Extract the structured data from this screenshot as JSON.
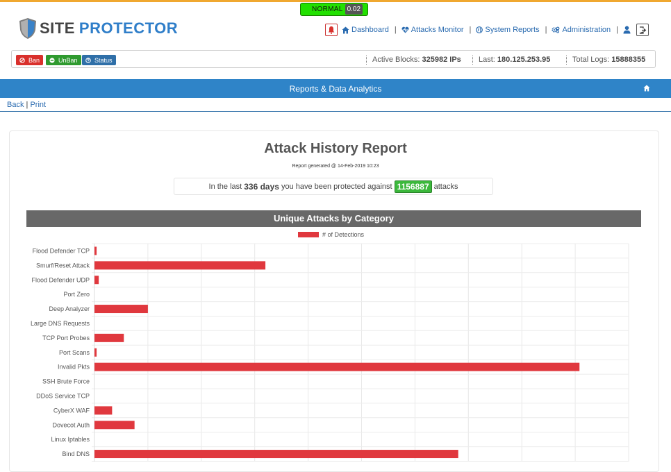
{
  "status_indicator": {
    "label": "NORMAL",
    "value": "0.02"
  },
  "brand": {
    "name_part1": "SITE",
    "name_part2": "PROTECTOR"
  },
  "nav": {
    "dashboard": "Dashboard",
    "attacks_monitor": "Attacks Monitor",
    "system_reports": "System Reports",
    "administration": "Administration",
    "separator": "|"
  },
  "toolbar": {
    "ban": "Ban",
    "unban": "UnBan",
    "status": "Status",
    "active_blocks_label": "Active Blocks:",
    "active_blocks_value": "325982 IPs",
    "last_label": "Last:",
    "last_value": "180.125.253.95",
    "total_logs_label": "Total Logs:",
    "total_logs_value": "15888355"
  },
  "section_bar": {
    "title": "Reports & Data Analytics"
  },
  "breadcrumbs": {
    "back": "Back",
    "sep": " | ",
    "print": "Print"
  },
  "report": {
    "title": "Attack History Report",
    "generated": "Report generated @ 14-Feb-2019 10:23",
    "protected_prefix": "In the last",
    "protected_days": "336 days",
    "protected_middle": "you have been protected against",
    "protected_count": "1156887",
    "protected_suffix": "attacks"
  },
  "colors": {
    "accent_blue": "#2f84c8",
    "bar_red": "#e0383e",
    "ok_green": "#3cb83c",
    "header_gray": "#686868"
  },
  "chart_data": {
    "type": "bar",
    "orientation": "horizontal",
    "title": "Unique Attacks by Category",
    "categories": [
      "Flood Defender TCP",
      "Smurf/Reset Attack",
      "Flood Defender UDP",
      "Port Zero",
      "Deep Analyzer",
      "Large DNS Requests",
      "TCP Port Probes",
      "Port Scans",
      "Invalid Pkts",
      "SSH Brute Force",
      "DDoS Service TCP",
      "CyberX WAF",
      "Dovecot Auth",
      "Linux Iptables",
      "Bind DNS"
    ],
    "series": [
      {
        "name": "# of Detections",
        "values": [
          0.4,
          32,
          0.8,
          0,
          10,
          0,
          5.5,
          0.4,
          90.8,
          0,
          0,
          3.3,
          7.5,
          0,
          68.1
        ]
      }
    ],
    "xlim": [
      0,
      100
    ],
    "legend": "top-center",
    "grid": true
  }
}
